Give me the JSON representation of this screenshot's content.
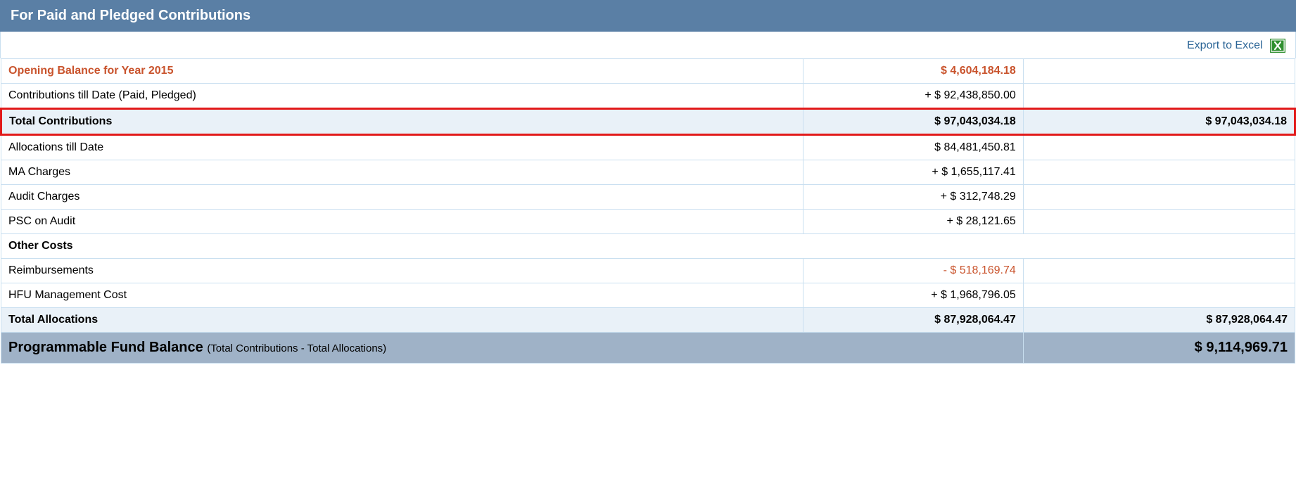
{
  "header": {
    "title": "For Paid and Pledged Contributions"
  },
  "export": {
    "label": "Export to Excel"
  },
  "rows": {
    "opening": {
      "label": "Opening Balance for Year 2015",
      "value": "$ 4,604,184.18"
    },
    "contributions_till_date": {
      "label": "Contributions till Date (Paid, Pledged)",
      "value": "+ $ 92,438,850.00"
    },
    "total_contributions": {
      "label": "Total Contributions",
      "value1": "$ 97,043,034.18",
      "value2": "$ 97,043,034.18"
    },
    "allocations_till_date": {
      "label": "Allocations till Date",
      "value": "$ 84,481,450.81"
    },
    "ma_charges": {
      "label": "MA Charges",
      "value": "+ $ 1,655,117.41"
    },
    "audit_charges": {
      "label": "Audit Charges",
      "value": "+ $ 312,748.29"
    },
    "psc_on_audit": {
      "label": "PSC on Audit",
      "value": "+ $ 28,121.65"
    },
    "other_costs": {
      "label": "Other Costs"
    },
    "reimbursements": {
      "label": "Reimbursements",
      "value": "- $ 518,169.74"
    },
    "hfu_mgmt": {
      "label": "HFU Management Cost",
      "value": "+ $ 1,968,796.05"
    },
    "total_allocations": {
      "label": "Total Allocations",
      "value1": "$ 87,928,064.47",
      "value2": "$ 87,928,064.47"
    },
    "footer": {
      "label": "Programmable Fund Balance",
      "sub": "(Total Contributions - Total Allocations)",
      "value": "$ 9,114,969.71"
    }
  }
}
